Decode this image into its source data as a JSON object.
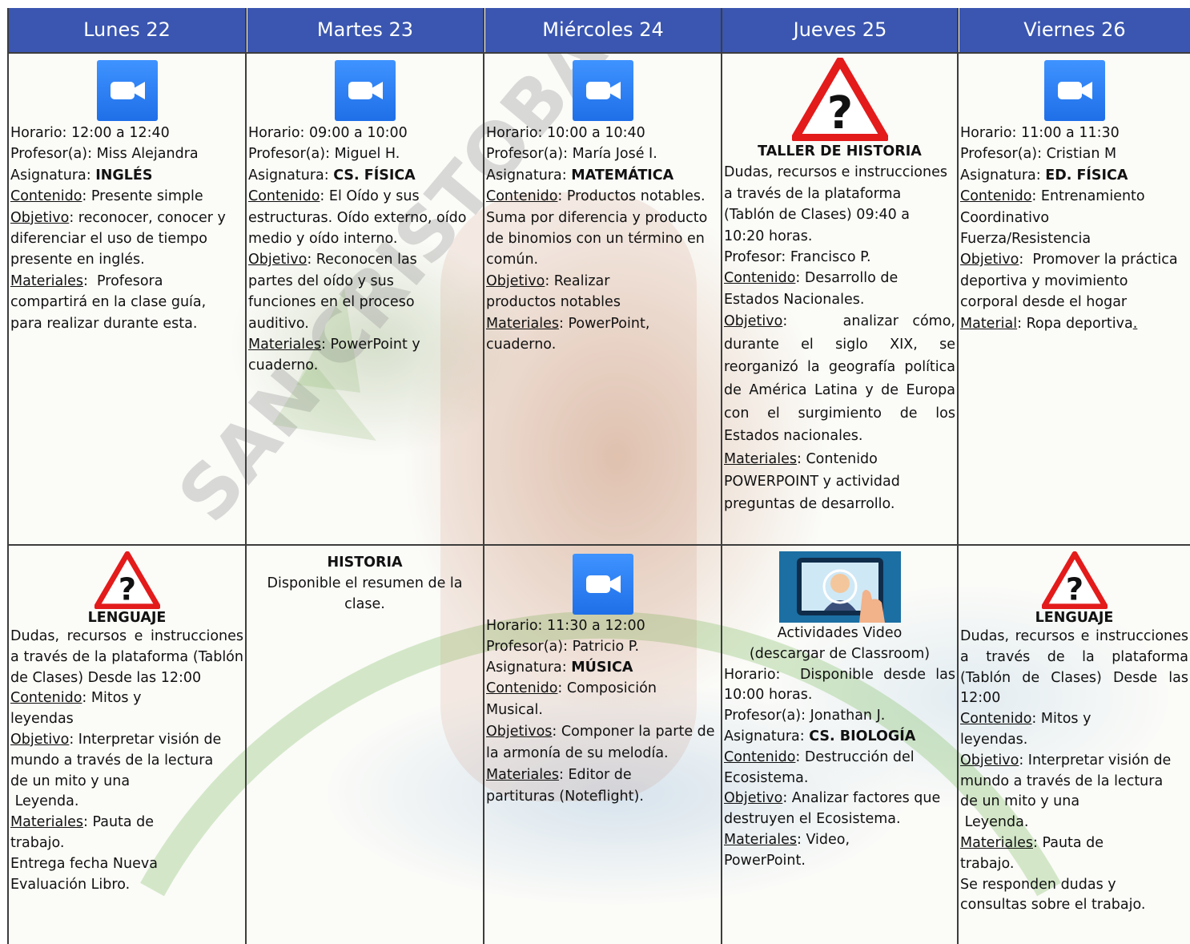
{
  "days": [
    "Lunes 22",
    "Martes 23",
    "Miércoles 24",
    "Jueves 25",
    "Viernes 26"
  ],
  "watermark": "SAN CRISTOBAL COLLEGE",
  "colors": {
    "header_bg": "#3a56b0",
    "zoom_blue": "#2d84f7",
    "warning_red": "#e31b1b"
  },
  "labels": {
    "horario": "Horario:",
    "profesor": "Profesor(a):",
    "asignatura": "Asignatura:",
    "contenido": "Contenido",
    "objetivo": "Objetivo",
    "objetivos": "Objetivos",
    "materiales": "Materiales",
    "material": "Material"
  },
  "row1": {
    "lunes": {
      "icon": "zoom-video-icon",
      "horario": "12:00 a 12:40",
      "profesor": "Miss Alejandra",
      "asignatura": "INGLÉS",
      "contenido": "Presente simple",
      "objetivo": "reconocer, conocer y diferenciar el uso de tiempo presente en inglés.",
      "materiales": "Profesora compartirá en la clase guía, para realizar durante esta."
    },
    "martes": {
      "icon": "zoom-video-icon",
      "horario": "09:00 a 10:00",
      "profesor": "Miguel H.",
      "asignatura": "CS. FÍSICA",
      "contenido": "El Oído y sus estructuras. Oído externo, oído medio y oído interno.",
      "objetivo": "Reconocen las partes del oído y sus funciones en el proceso auditivo.",
      "materiales": "PowerPoint y cuaderno."
    },
    "miercoles": {
      "icon": "zoom-video-icon",
      "horario": "10:00 a 10:40",
      "profesor": "María José I.",
      "asignatura": "MATEMÁTICA",
      "contenido": "Productos notables. Suma por diferencia y producto de binomios con un término en común.",
      "objetivo": "Realizar productos notables",
      "materiales": "PowerPoint, cuaderno."
    },
    "jueves": {
      "icon": "warning-question-icon",
      "title": "TALLER DE HISTORIA",
      "intro": "Dudas, recursos e instrucciones a través de la plataforma (Tablón de Clases) 09:40 a 10:20 horas.",
      "profesor_text": "Profesor: Francisco P.",
      "contenido": "Desarrollo de Estados Nacionales.",
      "objetivo": "analizar cómo, durante el siglo XIX, se reorganizó la geografía política de América Latina y de Europa con el surgimiento de los Estados nacionales.",
      "materiales": "Contenido POWERPOINT y actividad preguntas de desarrollo."
    },
    "viernes": {
      "icon": "zoom-video-icon",
      "horario": "11:00 a 11:30",
      "profesor": "Cristian M",
      "asignatura": "ED. FÍSICA",
      "contenido": "Entrenamiento Coordinativo Fuerza/Resistencia",
      "objetivo": "Promover la práctica deportiva y movimiento corporal desde el hogar",
      "material": "Ropa deportiva",
      "material_end": "."
    }
  },
  "row2": {
    "lunes": {
      "icon": "warning-question-icon",
      "title": "LENGUAJE",
      "intro": "Dudas, recursos e instrucciones a través de la plataforma (Tablón de Clases) Desde las 12:00",
      "contenido": "Mitos y leyendas",
      "objetivo": "Interpretar visión de mundo a través de la lectura de un mito y una",
      "objetivo_end": "Leyenda.",
      "materiales": "Pauta de trabajo.",
      "extra": "Entrega fecha Nueva Evaluación Libro."
    },
    "martes": {
      "title": "HISTORIA",
      "text": "Disponible el resumen de la clase."
    },
    "miercoles": {
      "icon": "zoom-video-icon",
      "horario": "11:30 a 12:00",
      "profesor": "Patricio P.",
      "asignatura": "MÚSICA",
      "contenido": "Composición Musical.",
      "objetivos": "Componer la parte de la armonía de su melodía.",
      "materiales": "Editor de partituras (Noteflight)."
    },
    "jueves": {
      "icon": "video-lesson-icon",
      "title1": "Actividades Video",
      "title2": "(descargar de Classroom)",
      "horario": "Disponible desde las 10:00 horas.",
      "profesor": "Jonathan J.",
      "asignatura": "CS. BIOLOGÍA",
      "contenido": "Destrucción del Ecosistema.",
      "objetivo": "Analizar factores que destruyen el Ecosistema.",
      "materiales": "Video, PowerPoint."
    },
    "viernes": {
      "icon": "warning-question-icon",
      "title": "LENGUAJE",
      "intro": "Dudas, recursos e instrucciones a través de la plataforma (Tablón de Clases) Desde las 12:00",
      "contenido": "Mitos y leyendas.",
      "objetivo": "Interpretar visión de mundo a través de la lectura de un mito y una",
      "objetivo_end": "Leyenda.",
      "materiales": "Pauta de trabajo.",
      "extra": "Se responden dudas y consultas sobre el trabajo."
    }
  }
}
